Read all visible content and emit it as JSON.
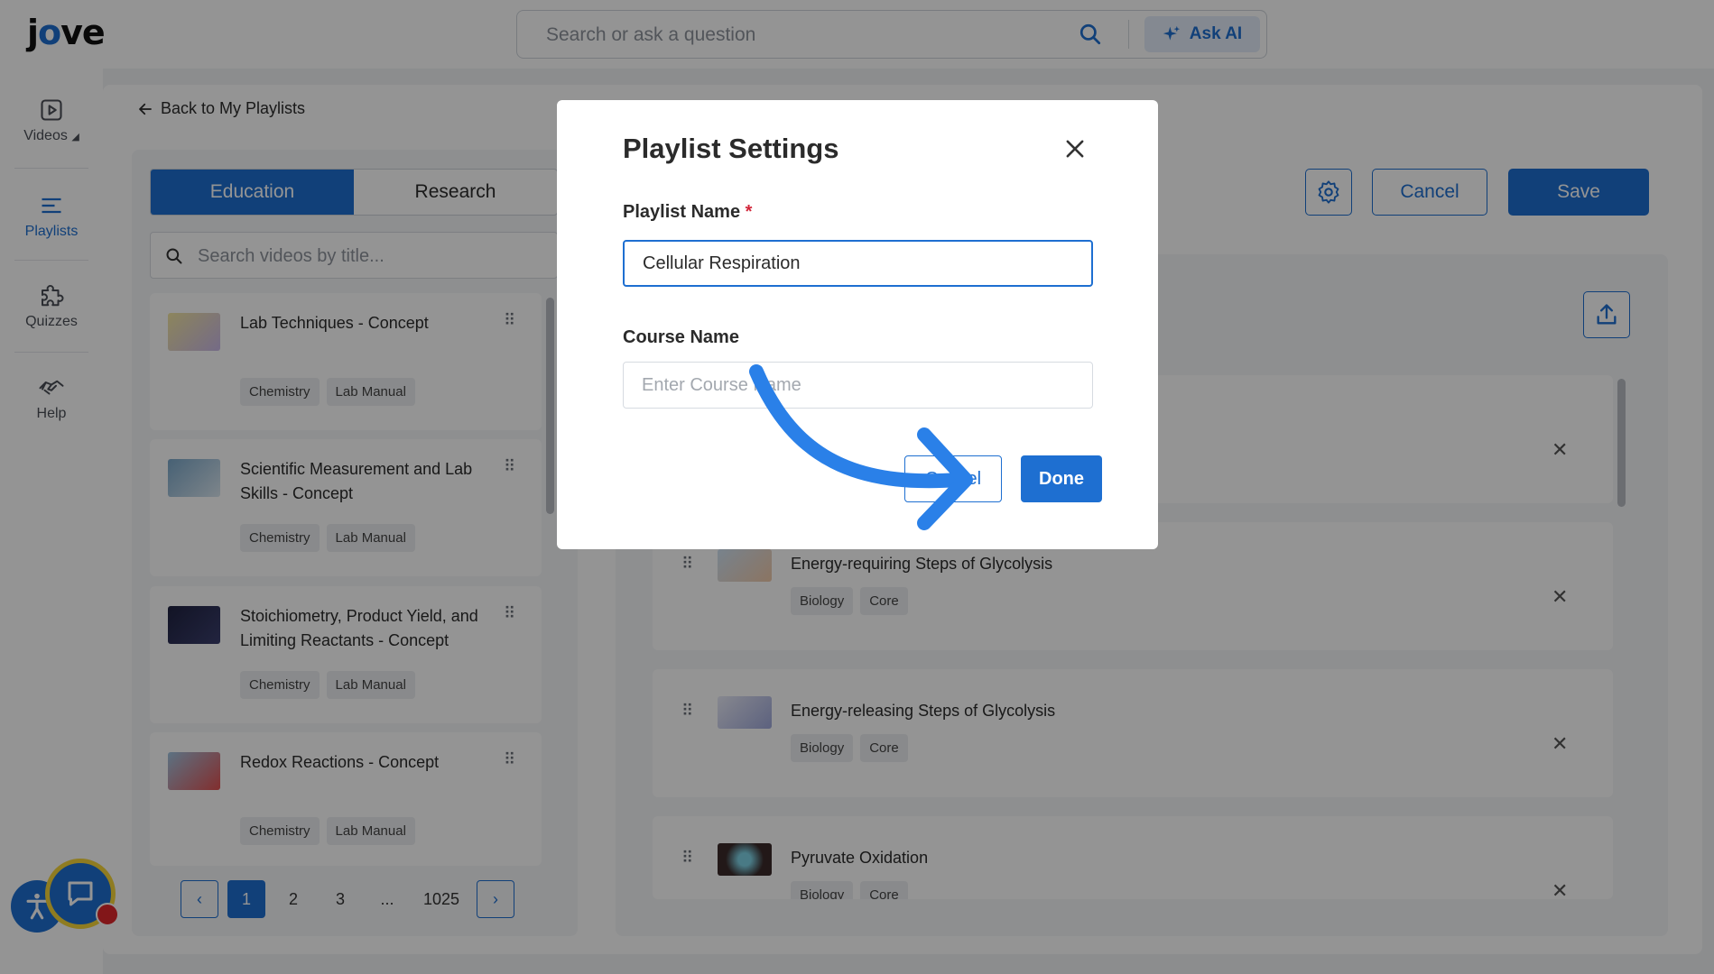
{
  "header": {
    "logo": {
      "j": "j",
      "o": "o",
      "ve": "ve"
    },
    "search_placeholder": "Search or ask a question",
    "ask_ai_label": "Ask AI"
  },
  "sidebar": {
    "items": [
      {
        "label": "Videos",
        "icon": "play-icon",
        "active": false
      },
      {
        "label": "Playlists",
        "icon": "list-icon",
        "active": true
      },
      {
        "label": "Quizzes",
        "icon": "puzzle-icon",
        "active": false
      },
      {
        "label": "Help",
        "icon": "handshake-icon",
        "active": false
      }
    ]
  },
  "back_link": "Back to My Playlists",
  "library": {
    "tabs": [
      "Education",
      "Research"
    ],
    "search_placeholder": "Search videos by title...",
    "videos": [
      {
        "title": "Lab Techniques - Concept",
        "tags": [
          "Chemistry",
          "Lab Manual"
        ]
      },
      {
        "title": "Scientific Measurement and Lab Skills - Concept",
        "tags": [
          "Chemistry",
          "Lab Manual"
        ]
      },
      {
        "title": "Stoichiometry, Product Yield, and Limiting Reactants - Concept",
        "tags": [
          "Chemistry",
          "Lab Manual"
        ]
      },
      {
        "title": "Redox Reactions - Concept",
        "tags": [
          "Chemistry",
          "Lab Manual"
        ]
      }
    ],
    "pagination": {
      "pages": [
        "1",
        "2",
        "3",
        "...",
        "1025"
      ],
      "current": "1"
    }
  },
  "toolbar": {
    "cancel_label": "Cancel",
    "save_label": "Save"
  },
  "playlist": {
    "items": [
      {
        "title": "Energy-requiring Steps of Glycolysis",
        "tags": [
          "Biology",
          "Core"
        ]
      },
      {
        "title": "Energy-releasing Steps of Glycolysis",
        "tags": [
          "Biology",
          "Core"
        ]
      },
      {
        "title": "Pyruvate Oxidation",
        "tags": [
          "Biology",
          "Core"
        ]
      }
    ]
  },
  "modal": {
    "title": "Playlist Settings",
    "name_label": "Playlist Name",
    "required_mark": "*",
    "name_value": "Cellular Respiration",
    "course_label": "Course Name",
    "course_placeholder": "Enter Course Name",
    "cancel_label": "Cancel",
    "done_label": "Done"
  },
  "colors": {
    "accent": "#1e6fd1",
    "required": "#d2263a",
    "chat_ring": "#f6d63a",
    "chat_badge": "#e0262b"
  }
}
